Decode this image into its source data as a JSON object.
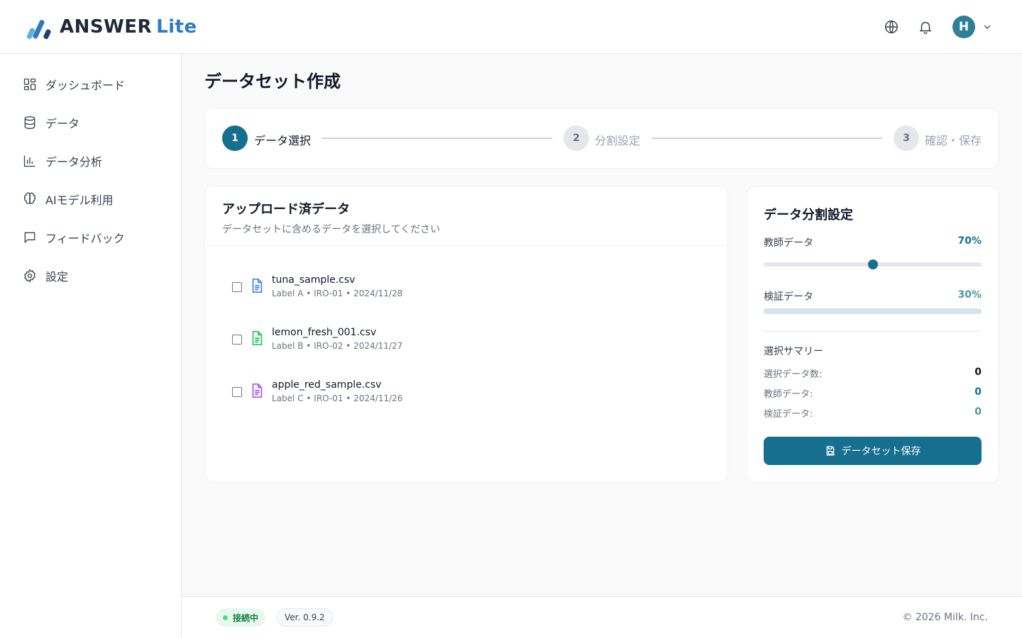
{
  "header": {
    "logo_text": "ANSWER",
    "logo_suffix": "Lite",
    "avatar_initial": "H",
    "icons": [
      "globe-icon",
      "bell-icon",
      "chevron-down-icon"
    ]
  },
  "sidebar": {
    "items": [
      {
        "label": "ダッシュボード",
        "icon": "dashboard-icon"
      },
      {
        "label": "データ",
        "icon": "database-icon"
      },
      {
        "label": "データ分析",
        "icon": "bar-chart-icon"
      },
      {
        "label": "AIモデル利用",
        "icon": "brain-icon"
      },
      {
        "label": "フィードバック",
        "icon": "message-icon"
      },
      {
        "label": "設定",
        "icon": "gear-icon"
      }
    ]
  },
  "main": {
    "title": "データセット作成",
    "steps": [
      {
        "number": "1",
        "label": "データ選択",
        "state": "active"
      },
      {
        "number": "2",
        "label": "分割設定",
        "state": "inactive"
      },
      {
        "number": "3",
        "label": "確認・保存",
        "state": "inactive"
      }
    ],
    "uploaded": {
      "title": "アップロード済データ",
      "subtitle": "データセットに含めるデータを選択してください",
      "files": [
        {
          "name": "tuna_sample.csv",
          "meta": "Label A • IRO-01 • 2024/11/28",
          "icon_color": "#3b82f6",
          "checked": false
        },
        {
          "name": "lemon_fresh_001.csv",
          "meta": "Label B • IRO-02 • 2024/11/27",
          "icon_color": "#22c55e",
          "checked": false
        },
        {
          "name": "apple_red_sample.csv",
          "meta": "Label C • IRO-01 • 2024/11/26",
          "icon_color": "#a855f7",
          "checked": false
        }
      ]
    },
    "split": {
      "title": "データ分割設定",
      "train_label": "教師データ",
      "train_pct": "70%",
      "train_fraction": 0.5,
      "val_label": "検証データ",
      "val_pct": "30%",
      "summary_title": "選択サマリー",
      "summary": [
        {
          "label": "選択データ数:",
          "value": "0",
          "color": "#111827"
        },
        {
          "label": "教師データ:",
          "value": "0",
          "color": "#176f8f"
        },
        {
          "label": "検証データ:",
          "value": "0",
          "color": "#4a9aa0"
        }
      ],
      "save_label": "データセット保存"
    }
  },
  "footer": {
    "status": "接続中",
    "version": "Ver. 0.9.2",
    "copyright": "© 2026 Milk. Inc."
  },
  "colors": {
    "primary": "#176f8f",
    "train_accent": "#176f8f",
    "val_accent": "#4a9aa0",
    "status_green": "#15803d"
  }
}
